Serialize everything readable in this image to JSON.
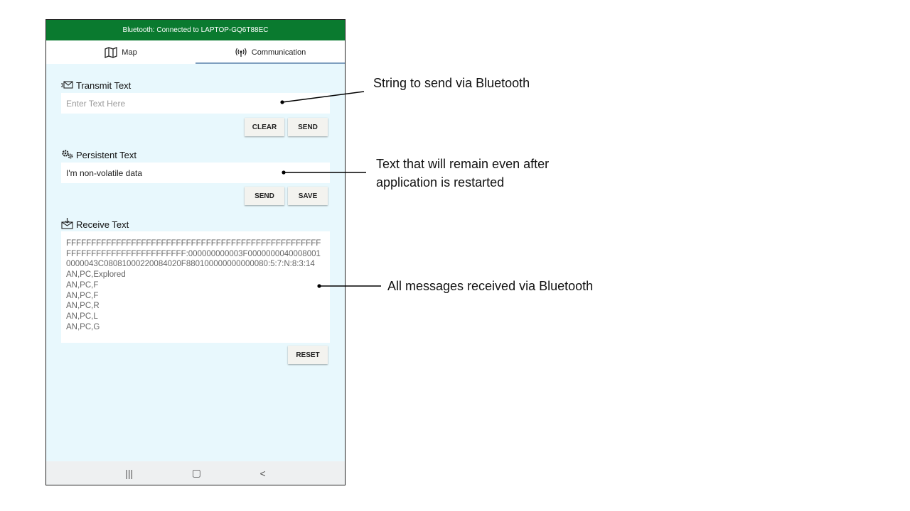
{
  "status_bar": {
    "text": "Bluetooth: Connected to LAPTOP-GQ6T88EC"
  },
  "tabs": [
    {
      "label": "Map",
      "icon": "map-icon"
    },
    {
      "label": "Communication",
      "icon": "broadcast-icon"
    }
  ],
  "transmit": {
    "title": "Transmit Text",
    "icon": "mail-send-icon",
    "placeholder": "Enter Text Here",
    "clear_label": "CLEAR",
    "send_label": "SEND"
  },
  "persistent": {
    "title": "Persistent Text",
    "icon": "gears-icon",
    "value": "I'm non-volatile data",
    "send_label": "SEND",
    "save_label": "SAVE"
  },
  "receive": {
    "title": "Receive Text",
    "icon": "inbox-mail-icon",
    "content": "FFFFFFFFFFFFFFFFFFFFFFFFFFFFFFFFFFFFFFFFFFFFFFFFFFFFFFFFFFFFFFFFFFFFFFFFFFF:000000000003F00000000400080010000043C08081000220084020F880100000000000080:5:7:N:8:3:14\nAN,PC,Explored\nAN,PC,F\nAN,PC,F\nAN,PC,R\nAN,PC,L\nAN,PC,G",
    "reset_label": "RESET"
  },
  "navbar": {
    "recents": "|||",
    "home": "▢",
    "back": "<"
  },
  "annotations": {
    "transmit": "String to send via Bluetooth",
    "persistent_line1": "Text that will remain even after",
    "persistent_line2": "application is restarted",
    "receive": "All messages received via Bluetooth"
  },
  "colors": {
    "status_bar": "#0a7a2f",
    "background": "#e8f8fd",
    "tab_underline": "#7e9fbf"
  }
}
